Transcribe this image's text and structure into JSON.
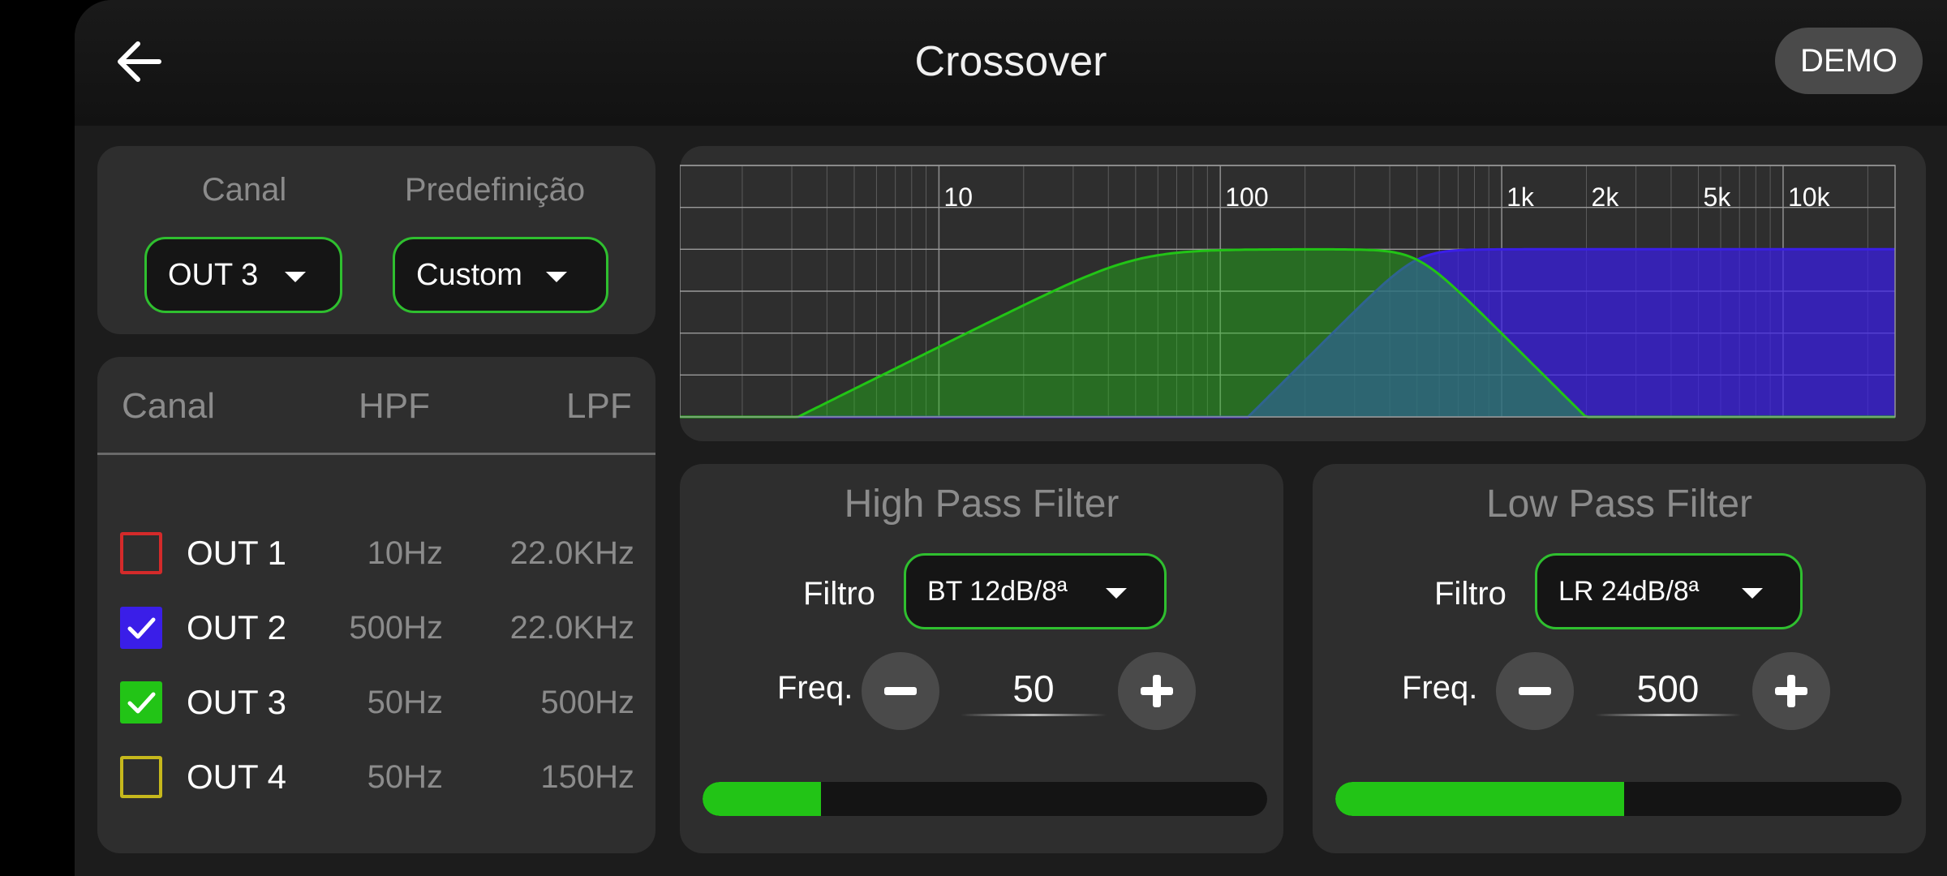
{
  "header": {
    "title": "Crossover",
    "demo_label": "DEMO"
  },
  "selectors": {
    "canal_label": "Canal",
    "preset_label": "Predefinição",
    "canal_value": "OUT 3",
    "preset_value": "Custom"
  },
  "table": {
    "headers": [
      "Canal",
      "HPF",
      "LPF"
    ],
    "rows": [
      {
        "name": "OUT 1",
        "hpf": "10Hz",
        "lpf": "22.0KHz",
        "checked": false,
        "color": "#d42a2a"
      },
      {
        "name": "OUT 2",
        "hpf": "500Hz",
        "lpf": "22.0KHz",
        "checked": true,
        "color": "#3a1ee8"
      },
      {
        "name": "OUT 3",
        "hpf": "50Hz",
        "lpf": "500Hz",
        "checked": true,
        "color": "#22c416"
      },
      {
        "name": "OUT 4",
        "hpf": "50Hz",
        "lpf": "150Hz",
        "checked": false,
        "color": "#c6b81c"
      }
    ]
  },
  "chart_data": {
    "type": "area",
    "x_scale": "log",
    "xlim": [
      1.2,
      25000
    ],
    "ylim": [
      -48,
      24
    ],
    "y_ticks": [
      "+24dB",
      "+12dB",
      "0dB",
      "-12dB",
      "-24dB",
      "-36dB",
      "-48dB"
    ],
    "x_tick_labels": [
      {
        "label": "10",
        "value": 10
      },
      {
        "label": "100",
        "value": 100
      },
      {
        "label": "1k",
        "value": 1000
      },
      {
        "label": "2k",
        "value": 2000
      },
      {
        "label": "5k",
        "value": 5000
      },
      {
        "label": "10k",
        "value": 10000
      }
    ],
    "series": [
      {
        "color": "#3a1ee8",
        "hpf_hz": 500,
        "hpf_db_per_oct": 24,
        "lpf_hz": 22000,
        "lpf_db_per_oct": 0
      },
      {
        "color": "#22c416",
        "hpf_hz": 50,
        "hpf_db_per_oct": 12,
        "lpf_hz": 500,
        "lpf_db_per_oct": 24
      }
    ]
  },
  "hpf": {
    "title": "High Pass Filter",
    "filter_label": "Filtro",
    "filter_value": "BT 12dB/8ª",
    "freq_label": "Freq.",
    "freq_value": "50",
    "level": 0.21
  },
  "lpf": {
    "title": "Low Pass Filter",
    "filter_label": "Filtro",
    "filter_value": "LR 24dB/8ª",
    "freq_label": "Freq.",
    "freq_value": "500",
    "level": 0.51
  }
}
